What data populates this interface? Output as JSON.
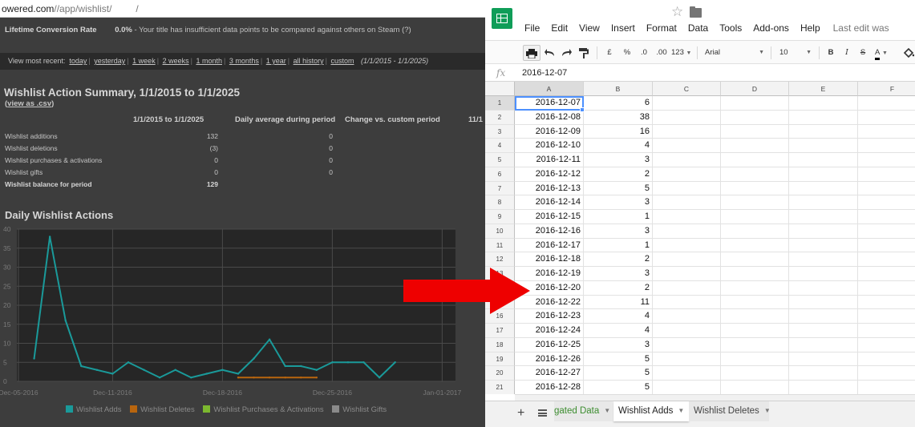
{
  "browser": {
    "url_host": "owered.com",
    "url_path": "//app/wishlist/",
    "url_slash": "/"
  },
  "conversion": {
    "label": "Lifetime Conversion Rate",
    "value": "0.0%",
    "note": " - Your title has insufficient data points to be compared against others on Steam",
    "help": "(?)"
  },
  "recent": {
    "label": "View most recent:",
    "links": [
      "today",
      "yesterday",
      "1 week",
      "2 weeks",
      "1 month",
      "3 months",
      "1 year",
      "all history",
      "custom"
    ],
    "range": "(1/1/2015 - 1/1/2025)"
  },
  "summary": {
    "title": "Wishlist Action Summary, 1/1/2015 to 1/1/2025",
    "csv_link": "view as .csv",
    "csv_open": "(",
    "csv_close": ")",
    "columns": [
      "1/1/2015 to 1/1/2025",
      "Daily average during period",
      "Change vs. custom period",
      "11/1"
    ],
    "rows": [
      {
        "label": "Wishlist additions",
        "total": "132",
        "avg": "0"
      },
      {
        "label": "Wishlist deletions",
        "total": "(3)",
        "avg": "0"
      },
      {
        "label": "Wishlist purchases & activations",
        "total": "0",
        "avg": "0"
      },
      {
        "label": "Wishlist gifts",
        "total": "0",
        "avg": "0"
      },
      {
        "label": "Wishlist balance for period",
        "total": "129",
        "avg": ""
      }
    ]
  },
  "chart_section_title": "Daily Wishlist Actions",
  "chart_data": {
    "type": "line",
    "x": [
      "2016-12-06",
      "2016-12-07",
      "2016-12-08",
      "2016-12-09",
      "2016-12-10",
      "2016-12-11",
      "2016-12-12",
      "2016-12-13",
      "2016-12-14",
      "2016-12-15",
      "2016-12-16",
      "2016-12-17",
      "2016-12-18",
      "2016-12-19",
      "2016-12-20",
      "2016-12-21",
      "2016-12-22",
      "2016-12-23",
      "2016-12-24",
      "2016-12-25",
      "2016-12-26",
      "2016-12-27",
      "2016-12-28",
      "2016-12-29",
      "2016-12-30"
    ],
    "series": [
      {
        "name": "Wishlist Adds",
        "color": "#1a9a9a",
        "values": [
          6,
          38,
          16,
          4,
          3,
          2,
          5,
          3,
          1,
          3,
          1,
          2,
          3,
          2,
          6,
          11,
          4,
          4,
          3,
          5,
          5,
          5,
          1,
          5,
          null
        ]
      },
      {
        "name": "Wishlist Deletes",
        "color": "#b8650e",
        "values": [
          null,
          null,
          null,
          null,
          null,
          null,
          null,
          null,
          null,
          null,
          null,
          null,
          null,
          1,
          1,
          1,
          1,
          1,
          1,
          null,
          null,
          null,
          null,
          null,
          null
        ]
      },
      {
        "name": "Wishlist Purchases & Activations",
        "color": "#7cb82f",
        "values": []
      },
      {
        "name": "Wishlist Gifts",
        "color": "#8a8a8a",
        "values": []
      }
    ],
    "y_ticks": [
      "0",
      "5",
      "10",
      "15",
      "20",
      "25",
      "30",
      "35",
      "40"
    ],
    "ylim": [
      0,
      40
    ],
    "x_tick_labels": [
      {
        "label": "Dec-05-2016",
        "date": "2016-12-05"
      },
      {
        "label": "Dec-11-2016",
        "date": "2016-12-11"
      },
      {
        "label": "Dec-18-2016",
        "date": "2016-12-18"
      },
      {
        "label": "Dec-25-2016",
        "date": "2016-12-25"
      },
      {
        "label": "Jan-01-2017",
        "date": "2017-01-01"
      }
    ],
    "grid": true,
    "legend_position": "bottom"
  },
  "sheets": {
    "menu": [
      "File",
      "Edit",
      "View",
      "Insert",
      "Format",
      "Data",
      "Tools",
      "Add-ons",
      "Help"
    ],
    "last_edit": "Last edit was",
    "toolbar": {
      "currency": "£",
      "percent": "%",
      "dec_less": ".0",
      "dec_more": ".00",
      "format_more": "123",
      "font": "Arial",
      "size": "10",
      "bold": "B",
      "italic": "I",
      "strike": "S",
      "text_color": "A"
    },
    "fx": "fx",
    "formula_value": "2016-12-07",
    "columns": [
      "A",
      "B",
      "C",
      "D",
      "E",
      "F"
    ],
    "rows": [
      {
        "n": "1",
        "a": "2016-12-07",
        "b": "6"
      },
      {
        "n": "2",
        "a": "2016-12-08",
        "b": "38"
      },
      {
        "n": "3",
        "a": "2016-12-09",
        "b": "16"
      },
      {
        "n": "4",
        "a": "2016-12-10",
        "b": "4"
      },
      {
        "n": "5",
        "a": "2016-12-11",
        "b": "3"
      },
      {
        "n": "6",
        "a": "2016-12-12",
        "b": "2"
      },
      {
        "n": "7",
        "a": "2016-12-13",
        "b": "5"
      },
      {
        "n": "8",
        "a": "2016-12-14",
        "b": "3"
      },
      {
        "n": "9",
        "a": "2016-12-15",
        "b": "1"
      },
      {
        "n": "10",
        "a": "2016-12-16",
        "b": "3"
      },
      {
        "n": "11",
        "a": "2016-12-17",
        "b": "1"
      },
      {
        "n": "12",
        "a": "2016-12-18",
        "b": "2"
      },
      {
        "n": "13",
        "a": "2016-12-19",
        "b": "3"
      },
      {
        "n": "14",
        "a": "2016-12-20",
        "b": "2"
      },
      {
        "n": "15",
        "a": "2016-12-22",
        "b": "11"
      },
      {
        "n": "16",
        "a": "2016-12-23",
        "b": "4"
      },
      {
        "n": "17",
        "a": "2016-12-24",
        "b": "4"
      },
      {
        "n": "18",
        "a": "2016-12-25",
        "b": "3"
      },
      {
        "n": "19",
        "a": "2016-12-26",
        "b": "5"
      },
      {
        "n": "20",
        "a": "2016-12-27",
        "b": "5"
      },
      {
        "n": "21",
        "a": "2016-12-28",
        "b": "5"
      }
    ],
    "tabs": [
      {
        "label": "gated Data"
      },
      {
        "label": "Wishlist Adds"
      },
      {
        "label": "Wishlist Deletes"
      }
    ],
    "add_sheet": "+"
  },
  "colors": {
    "arrow": "#ee0000",
    "sheets_green": "#0f9d58",
    "teal_line": "#1a9a9a",
    "selection_blue": "#4d90fe"
  }
}
